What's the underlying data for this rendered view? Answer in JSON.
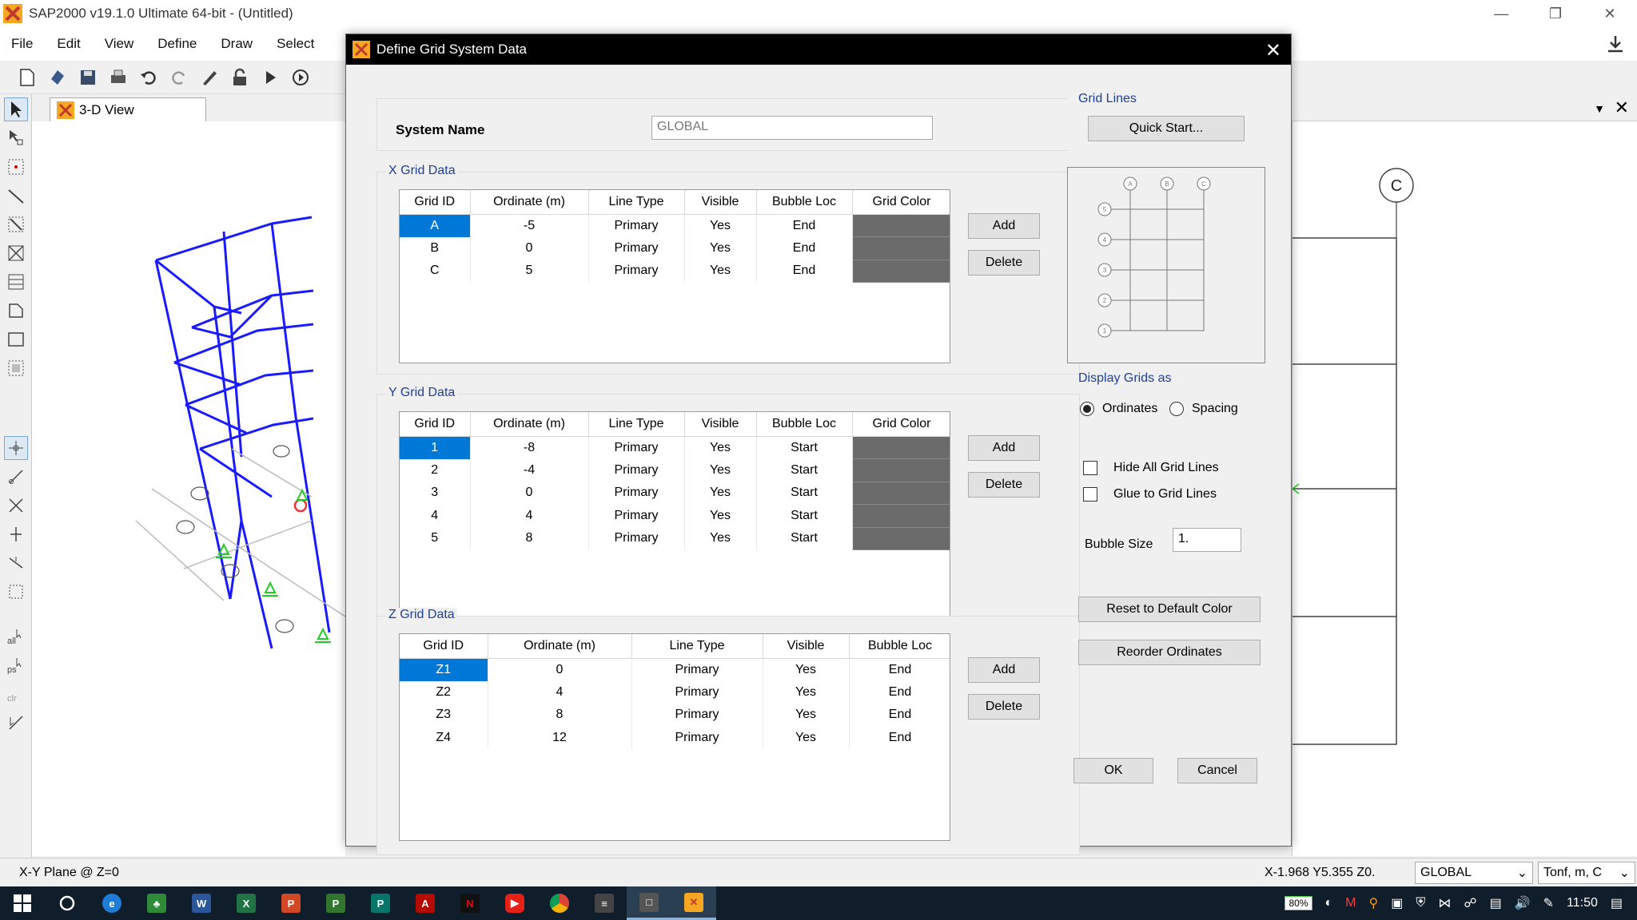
{
  "app": {
    "title": "SAP2000 v19.1.0 Ultimate 64-bit - (Untitled)",
    "menu": [
      "File",
      "Edit",
      "View",
      "Define",
      "Draw",
      "Select"
    ],
    "view_tab": "3-D View",
    "right_bubble": "C"
  },
  "status": {
    "plane": "X-Y Plane @ Z=0",
    "coords": "X-1.968  Y5.355  Z0.",
    "coord_system": "GLOBAL",
    "units": "Tonf, m, C"
  },
  "taskbar": {
    "battery": "80%",
    "time": "11:50"
  },
  "dialog": {
    "title": "Define Grid System Data",
    "system_name_label": "System Name",
    "system_name_value": "GLOBAL",
    "x_grid": {
      "label": "X Grid Data",
      "headers": [
        "Grid ID",
        "Ordinate (m)",
        "Line Type",
        "Visible",
        "Bubble Loc",
        "Grid Color"
      ],
      "rows": [
        {
          "id": "A",
          "ordinate": "-5",
          "line_type": "Primary",
          "visible": "Yes",
          "bubble_loc": "End"
        },
        {
          "id": "B",
          "ordinate": "0",
          "line_type": "Primary",
          "visible": "Yes",
          "bubble_loc": "End"
        },
        {
          "id": "C",
          "ordinate": "5",
          "line_type": "Primary",
          "visible": "Yes",
          "bubble_loc": "End"
        }
      ]
    },
    "y_grid": {
      "label": "Y Grid Data",
      "headers": [
        "Grid ID",
        "Ordinate (m)",
        "Line Type",
        "Visible",
        "Bubble Loc",
        "Grid Color"
      ],
      "rows": [
        {
          "id": "1",
          "ordinate": "-8",
          "line_type": "Primary",
          "visible": "Yes",
          "bubble_loc": "Start"
        },
        {
          "id": "2",
          "ordinate": "-4",
          "line_type": "Primary",
          "visible": "Yes",
          "bubble_loc": "Start"
        },
        {
          "id": "3",
          "ordinate": "0",
          "line_type": "Primary",
          "visible": "Yes",
          "bubble_loc": "Start"
        },
        {
          "id": "4",
          "ordinate": "4",
          "line_type": "Primary",
          "visible": "Yes",
          "bubble_loc": "Start"
        },
        {
          "id": "5",
          "ordinate": "8",
          "line_type": "Primary",
          "visible": "Yes",
          "bubble_loc": "Start"
        }
      ]
    },
    "z_grid": {
      "label": "Z Grid Data",
      "headers": [
        "Grid ID",
        "Ordinate (m)",
        "Line Type",
        "Visible",
        "Bubble Loc"
      ],
      "rows": [
        {
          "id": "Z1",
          "ordinate": "0",
          "line_type": "Primary",
          "visible": "Yes",
          "bubble_loc": "End"
        },
        {
          "id": "Z2",
          "ordinate": "4",
          "line_type": "Primary",
          "visible": "Yes",
          "bubble_loc": "End"
        },
        {
          "id": "Z3",
          "ordinate": "8",
          "line_type": "Primary",
          "visible": "Yes",
          "bubble_loc": "End"
        },
        {
          "id": "Z4",
          "ordinate": "12",
          "line_type": "Primary",
          "visible": "Yes",
          "bubble_loc": "End"
        }
      ]
    },
    "add_label": "Add",
    "delete_label": "Delete",
    "grid_lines_label": "Grid Lines",
    "quick_start_label": "Quick Start...",
    "preview_cols": [
      "A",
      "B",
      "C"
    ],
    "preview_rows": [
      "5",
      "4",
      "3",
      "2",
      "1"
    ],
    "display_grids_label": "Display Grids as",
    "radio_ordinates": "Ordinates",
    "radio_spacing": "Spacing",
    "display_selected": "Ordinates",
    "hide_all_grid_lines": "Hide All Grid Lines",
    "glue_to_grid_lines": "Glue to Grid Lines",
    "bubble_size_label": "Bubble Size",
    "bubble_size_value": "1.",
    "reset_color_label": "Reset to Default Color",
    "reorder_label": "Reorder Ordinates",
    "ok_label": "OK",
    "cancel_label": "Cancel",
    "grid_color": "#6b6b6b",
    "selection_color": "#0078d7",
    "section_label_color": "#1f3f9a"
  }
}
